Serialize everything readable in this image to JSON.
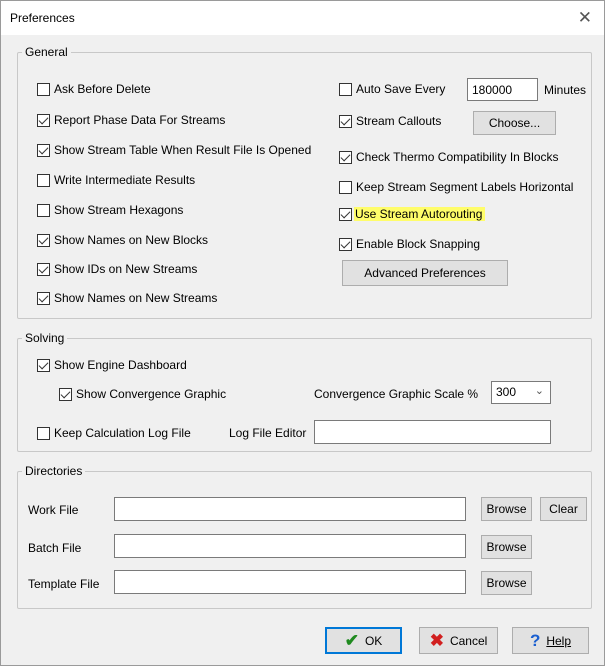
{
  "window": {
    "title": "Preferences",
    "close_glyph": "✕"
  },
  "general": {
    "legend": "General",
    "left_items": [
      {
        "label": "Ask Before Delete",
        "checked": false
      },
      {
        "label": "Report Phase Data For Streams",
        "checked": true
      },
      {
        "label": "Show Stream Table When Result File Is Opened",
        "checked": true
      },
      {
        "label": "Write Intermediate Results",
        "checked": false
      },
      {
        "label": "Show Stream Hexagons",
        "checked": false
      },
      {
        "label": "Show Names on New Blocks",
        "checked": true
      },
      {
        "label": "Show IDs on New Streams",
        "checked": true
      },
      {
        "label": "Show Names on New Streams",
        "checked": true
      }
    ],
    "auto_save": {
      "label": "Auto Save Every",
      "checked": false,
      "value": "180000",
      "unit": "Minutes"
    },
    "stream_callouts": {
      "label": "Stream Callouts",
      "checked": true,
      "button": "Choose..."
    },
    "check_thermo": {
      "label": "Check Thermo Compatibility In Blocks",
      "checked": true
    },
    "keep_labels": {
      "label": "Keep Stream Segment Labels Horizontal",
      "checked": false
    },
    "autorouting": {
      "label": "Use Stream Autorouting",
      "checked": true,
      "highlight_color": "#fffd6a"
    },
    "block_snapping": {
      "label": "Enable Block Snapping",
      "checked": true
    },
    "advanced_button": "Advanced Preferences"
  },
  "solving": {
    "legend": "Solving",
    "engine_dashboard": {
      "label": "Show Engine Dashboard",
      "checked": true
    },
    "convergence_graphic": {
      "label": "Show Convergence Graphic",
      "checked": true
    },
    "scale_label": "Convergence Graphic Scale %",
    "scale_value": "300",
    "keep_log": {
      "label": "Keep Calculation Log File",
      "checked": false
    },
    "log_editor_label": "Log File Editor",
    "log_editor_value": ""
  },
  "directories": {
    "legend": "Directories",
    "work_label": "Work File",
    "work_value": "",
    "batch_label": "Batch File",
    "batch_value": "",
    "template_label": "Template File",
    "template_value": "",
    "browse": "Browse",
    "clear": "Clear"
  },
  "footer": {
    "ok": "OK",
    "cancel": "Cancel",
    "help": "Help",
    "ok_icon_color": "#1f8a1f",
    "cancel_icon_color": "#d11f1f",
    "help_icon_color": "#1a5fd0"
  }
}
